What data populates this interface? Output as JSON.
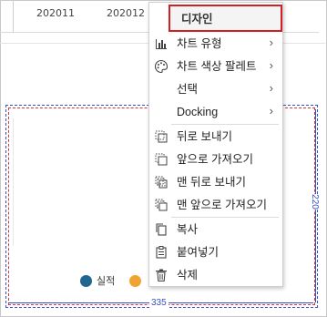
{
  "chart_fragment": {
    "x_labels": [
      "202011",
      "202012"
    ]
  },
  "selection": {
    "height_label": "220",
    "width_label": "335"
  },
  "legend": {
    "items": [
      {
        "label": "실적",
        "color": "#1f6690"
      },
      {
        "label": "",
        "color": "#f0a233"
      }
    ]
  },
  "context_menu": {
    "items": [
      {
        "label": "디자인",
        "icon": "none"
      },
      {
        "label": "차트 유형",
        "icon": "bar-chart-icon",
        "submenu": true
      },
      {
        "label": "차트 색상 팔레트",
        "icon": "palette-icon",
        "submenu": true
      },
      {
        "label": "선택",
        "icon": "none",
        "submenu": true
      },
      {
        "label": "Docking",
        "icon": "none",
        "submenu": true
      },
      {
        "label": "뒤로 보내기",
        "icon": "send-backward-icon"
      },
      {
        "label": "앞으로 가져오기",
        "icon": "bring-forward-icon"
      },
      {
        "label": "맨 뒤로 보내기",
        "icon": "send-to-back-icon"
      },
      {
        "label": "맨 앞으로 가져오기",
        "icon": "bring-to-front-icon"
      },
      {
        "label": "복사",
        "icon": "copy-icon"
      },
      {
        "label": "붙여넣기",
        "icon": "paste-icon"
      },
      {
        "label": "삭제",
        "icon": "delete-icon"
      }
    ],
    "submenu_arrow": "›"
  },
  "colors": {
    "highlight_border": "#d11f25",
    "selection_blue": "#3a4ec8",
    "selection_red": "#d0364a"
  }
}
